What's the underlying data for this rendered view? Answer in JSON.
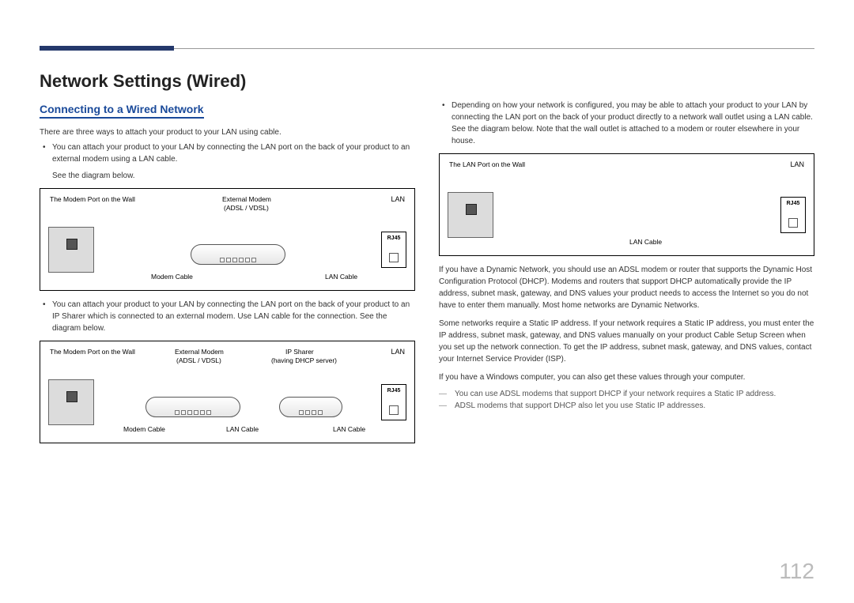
{
  "header": {
    "title": "Network Settings (Wired)",
    "subtitle": "Connecting to a Wired Network"
  },
  "left": {
    "intro": "There are three ways to attach your product to your LAN using cable.",
    "bullet1": "You can attach your product to your LAN by connecting the LAN port on the back of your product to an external modem using a LAN cable.",
    "seeBelow": "See the diagram below.",
    "bullet2": "You can attach your product to your LAN by connecting the LAN port on the back of your product to an IP Sharer which is connected to an external modem. Use LAN cable for the connection. See the diagram below."
  },
  "right": {
    "bullet3": "Depending on how your network is configured, you may be able to attach your product to your LAN by connecting the LAN port on the back of your product directly to a network wall outlet using a LAN cable.",
    "bullet3b": "See the diagram below. Note that the wall outlet is attached to a modem or router elsewhere in your house.",
    "para1": "If you have a Dynamic Network, you should use an ADSL modem or router that supports the Dynamic Host Configuration Protocol (DHCP). Modems and routers that support DHCP automatically provide the IP address, subnet mask, gateway, and DNS values your product needs to access the Internet so you do not have to enter them manually. Most home networks are Dynamic Networks.",
    "para2": "Some networks require a Static IP address. If your network requires a Static IP address, you must enter the IP address, subnet mask, gateway, and DNS values manually on your product Cable Setup Screen when you set up the network connection. To get the IP address, subnet mask, gateway, and DNS values, contact your Internet Service Provider (ISP).",
    "para3": "If you have a Windows computer, you can also get these values through your computer.",
    "note1": "You can use ADSL modems that support DHCP if your network requires a Static IP address.",
    "note2": "ADSL modems that support DHCP also let you use Static IP addresses."
  },
  "diagram_labels": {
    "wallModem": "The Modem Port on the Wall",
    "wallLan": "The LAN Port on the Wall",
    "externalModem": "External Modem",
    "adslVdsl": "(ADSL / VDSL)",
    "ipSharer": "IP Sharer",
    "dhcpServer": "(having DHCP server)",
    "lan": "LAN",
    "rj45": "RJ45",
    "modemCable": "Modem Cable",
    "lanCable": "LAN Cable"
  },
  "page_number": "112"
}
